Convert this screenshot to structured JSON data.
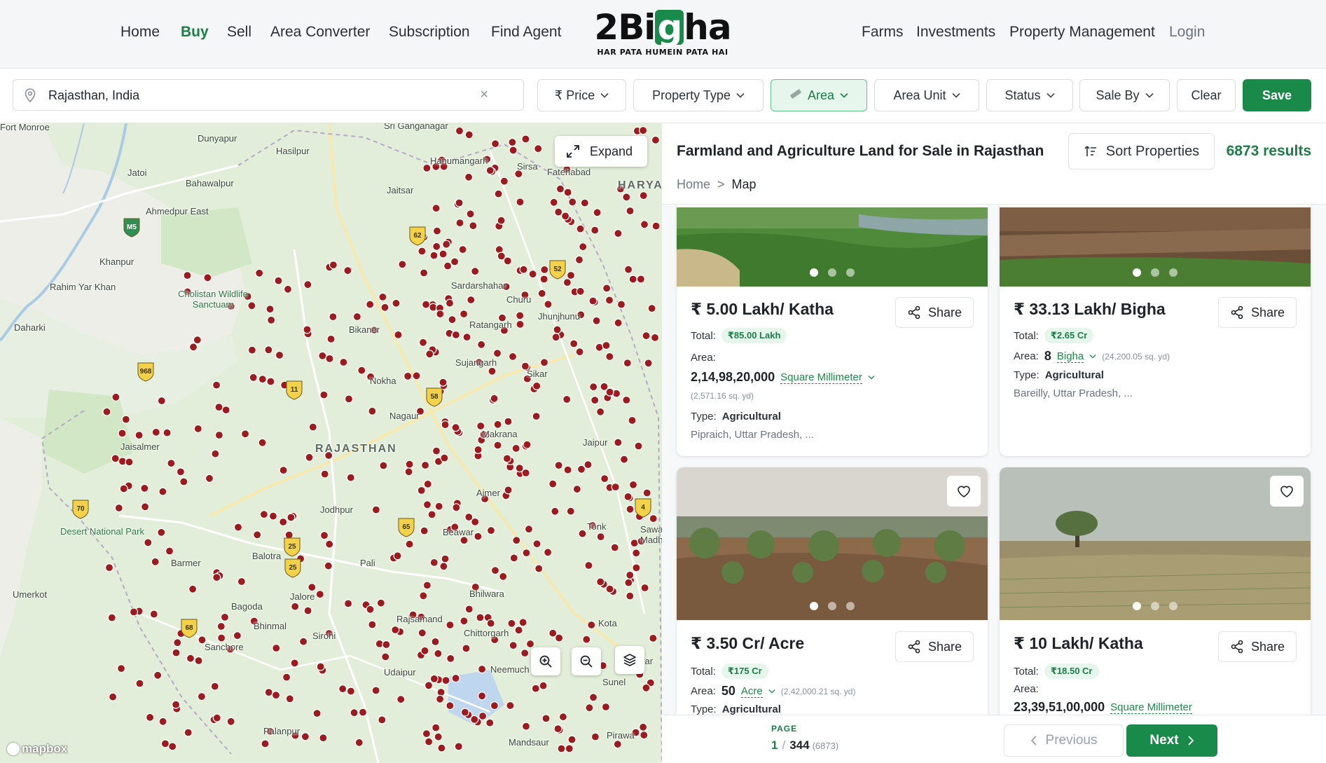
{
  "nav": {
    "left": [
      "Home",
      "Buy",
      "Sell",
      "Area Converter",
      "Subscription",
      "Find Agent"
    ],
    "right": [
      "Farms",
      "Investments",
      "Property Management",
      "Login"
    ],
    "logo_prefix": "2Bi",
    "logo_g": "g",
    "logo_suffix": "ha",
    "logo_tagline": "HAR PATA HUMEIN PATA HAI"
  },
  "filters": {
    "search_value": "Rajasthan, India",
    "clear_x": "×",
    "price": "₹ Price",
    "property_type": "Property Type",
    "area": "Area",
    "area_unit": "Area Unit",
    "status": "Status",
    "sale_by": "Sale By",
    "clear": "Clear",
    "save": "Save"
  },
  "map": {
    "expand_label": "Expand",
    "attribution": "mapbox",
    "region_label": "RAJASTHAN",
    "places": [
      "Sri Ganganagar",
      "Fort Monroe",
      "Dunyapur",
      "Hasilpur",
      "Jatoi",
      "Bahawalpur",
      "Ahmedpur East",
      "Hanumangarh",
      "Sirsa",
      "Fatehabad",
      "HARYANA",
      "Jaitsar",
      "Khanpur",
      "Rahim Yar Khan",
      "Cholistan Wildlife Sanctuary",
      "Daharki",
      "Sardarshahar",
      "Churu",
      "Jhunjhunu",
      "Ratangarh",
      "Bikaner",
      "Sujangarh",
      "Sikar",
      "Nokha",
      "Nagaur",
      "Makrana",
      "Jaipur",
      "Jaisalmer",
      "Jodhpur",
      "Ajmer",
      "Beawar",
      "Tonk",
      "Sawai Madhopur",
      "Desert National Park",
      "Balotra",
      "Pali",
      "Barmer",
      "Umerkot",
      "Jalore",
      "Bhilwara",
      "Bagoda",
      "Bhinmal",
      "Sirohi",
      "Rajsamand",
      "Chittorgarh",
      "Kota",
      "Sanchore",
      "Udaipur",
      "Neemuch",
      "Jhalawar",
      "Sunel",
      "Palanpur",
      "Mandsaur",
      "Pirawa"
    ],
    "shields": [
      "M5",
      "62",
      "52",
      "968",
      "11",
      "58",
      "70",
      "25",
      "68",
      "65",
      "4",
      "25"
    ]
  },
  "results": {
    "title": "Farmland and Agriculture Land for Sale in Rajasthan",
    "sort_label": "Sort Properties",
    "count_label": "6873 results",
    "breadcrumb": [
      "Home",
      ">",
      "Map"
    ]
  },
  "labels": {
    "total": "Total:",
    "area": "Area:",
    "type": "Type:",
    "share": "Share"
  },
  "cards": [
    {
      "price": "₹ 5.00 Lakh/ Katha",
      "total": "₹85.00 Lakh",
      "area_value": "2,14,98,20,000",
      "area_unit": "Square Millimeter",
      "area_note": "(2,571.16 sq. yd)",
      "type": "Agricultural",
      "location": "Pipraich, Uttar Pradesh, ..."
    },
    {
      "price": "₹ 33.13 Lakh/ Bigha",
      "total": "₹2.65 Cr",
      "area_value": "8",
      "area_unit": "Bigha",
      "area_note": "(24,200.05 sq. yd)",
      "type": "Agricultural",
      "location": "Bareilly, Uttar Pradesh, ..."
    },
    {
      "price": "₹ 3.50 Cr/ Acre",
      "total": "₹175 Cr",
      "area_value": "50",
      "area_unit": "Acre",
      "area_note": "(2,42,000.21 sq. yd)",
      "type": "Agricultural",
      "location": ""
    },
    {
      "price": "₹ 10 Lakh/ Katha",
      "total": "₹18.50 Cr",
      "area_value": "23,39,51,00,000",
      "area_unit": "Square Millimeter",
      "area_note": "",
      "type": "",
      "location": ""
    }
  ],
  "pagination": {
    "label": "PAGE",
    "current": "1",
    "separator": "/",
    "total_pages": "344",
    "total_count": "(6873)",
    "previous": "Previous",
    "next": "Next"
  },
  "colors": {
    "brand_green": "#1a8a4a",
    "active_nav": "#1a7f45",
    "marker": "#9b1b1f",
    "map_land": "#e2eed9",
    "map_desert": "#f1f0ec"
  }
}
